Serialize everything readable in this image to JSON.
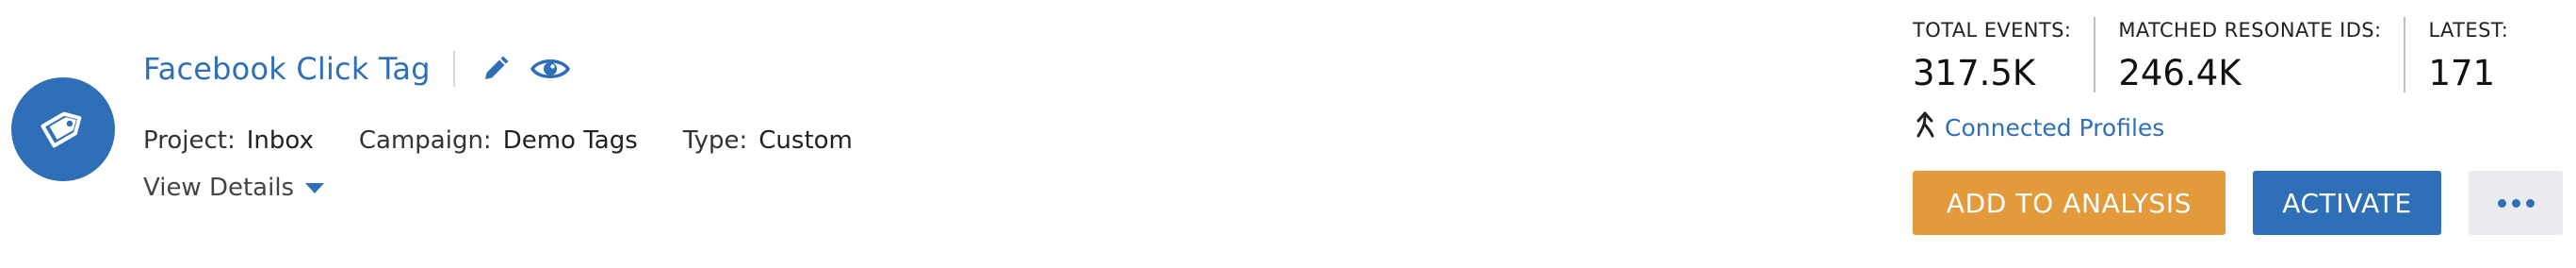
{
  "tag": {
    "title": "Facebook Click Tag",
    "icon": "tag-icon",
    "edit_icon": "pencil-icon",
    "view_icon": "eye-icon"
  },
  "meta": {
    "project_label": "Project:",
    "project_value": "Inbox",
    "campaign_label": "Campaign:",
    "campaign_value": "Demo Tags",
    "type_label": "Type:",
    "type_value": "Custom"
  },
  "view_details": {
    "label": "View Details",
    "icon": "caret-down-icon"
  },
  "stats": {
    "total_events_label": "TOTAL EVENTS:",
    "total_events_value": "317.5K",
    "matched_ids_label": "MATCHED RESONATE IDS:",
    "matched_ids_value": "246.4K",
    "latest_label": "LATEST:",
    "latest_value": "171"
  },
  "connected_profiles": {
    "label": "Connected Profiles",
    "icon": "merge-arrow-icon"
  },
  "actions": {
    "add_to_analysis": "ADD TO ANALYSIS",
    "activate": "ACTIVATE",
    "more_icon": "more-horizontal-icon"
  },
  "colors": {
    "primary_blue": "#2f6fb7",
    "orange": "#e39a3a",
    "more_button_bg": "#e9ebef"
  }
}
